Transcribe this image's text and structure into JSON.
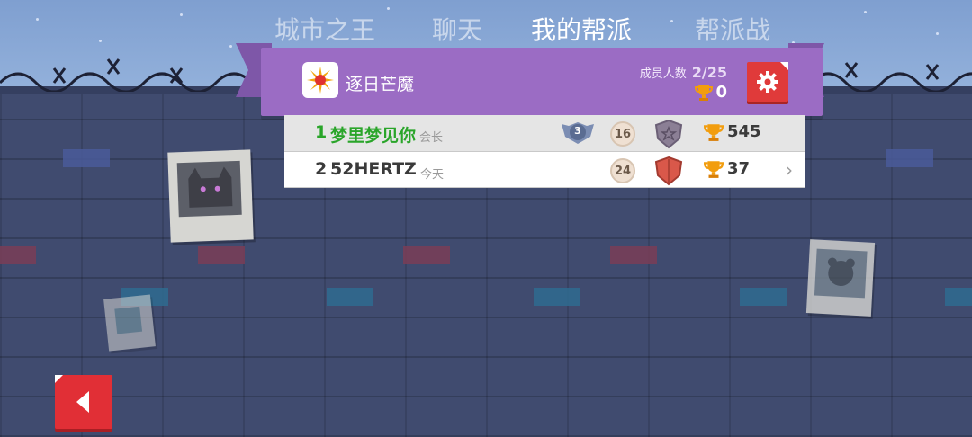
{
  "tabs": [
    {
      "label": "城市之王",
      "active": false
    },
    {
      "label": "聊天",
      "active": false
    },
    {
      "label": "我的帮派",
      "active": true
    },
    {
      "label": "帮派战",
      "active": false
    }
  ],
  "gang": {
    "name": "逐日芒魔",
    "members_label": "成员人数",
    "members_count": "2/25",
    "trophies": "0",
    "emblem_icon": "sun-emblem-icon"
  },
  "members": [
    {
      "rank": "1",
      "name": "梦里梦见你",
      "role": "会长",
      "badge_level": "3",
      "level": "16",
      "trophies": "545",
      "name_color": "#2aa52a"
    },
    {
      "rank": "2",
      "name": "52HERTZ",
      "role": "今天",
      "badge_level": "",
      "level": "24",
      "trophies": "37",
      "name_color": "#3a3a3a"
    }
  ],
  "colors": {
    "ribbon": "#9b6cc4",
    "accent_red": "#e03a3a",
    "wall": "#404b6f",
    "sky": "#8aa9d6",
    "leader_green": "#2aa52a"
  }
}
